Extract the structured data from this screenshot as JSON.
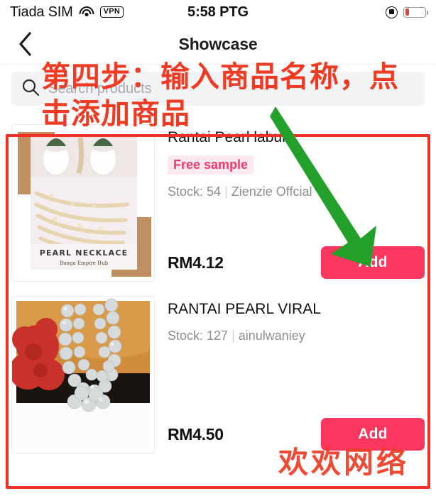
{
  "status_bar": {
    "carrier": "Tiada SIM",
    "wifi_icon": "wifi-icon",
    "vpn_label": "VPN",
    "time": "5:58 PTG",
    "rotation_lock_icon": "rotation-lock-icon",
    "battery_icon": "battery-low-icon",
    "battery_color": "#e8413c"
  },
  "header": {
    "back_icon": "chevron-left-icon",
    "title": "Showcase"
  },
  "search": {
    "icon": "search-icon",
    "placeholder": "Search products",
    "value": ""
  },
  "products": [
    {
      "name": "Rantai Pearl labuh",
      "badge": "Free sample",
      "stock_label": "Stock: 54",
      "separator": "|",
      "seller": "Zienzie Offcial",
      "price": "RM4.12",
      "add_label": "Add",
      "image_alt": "pearl-necklace-product-image"
    },
    {
      "name": "RANTAI PEARL VIRAL",
      "badge": "",
      "stock_label": "Stock: 127",
      "separator": "|",
      "seller": "ainulwaniey",
      "price": "RM4.50",
      "add_label": "Add",
      "image_alt": "grey-pearl-necklace-product-image"
    }
  ],
  "annotations": {
    "instruction_text": "第四步：输入商品名称，点\n击添加商品",
    "instruction_color": "#ef3b24",
    "highlight_box_color": "#ee3124",
    "arrow_color": "#22a02a",
    "watermark_text": "欢欢网络",
    "watermark_color": "#ef3b24"
  },
  "theme": {
    "accent": "#f9375f",
    "badge_bg": "#fdeaf0",
    "badge_text": "#f0386b",
    "search_bg": "#f2f3f5"
  }
}
